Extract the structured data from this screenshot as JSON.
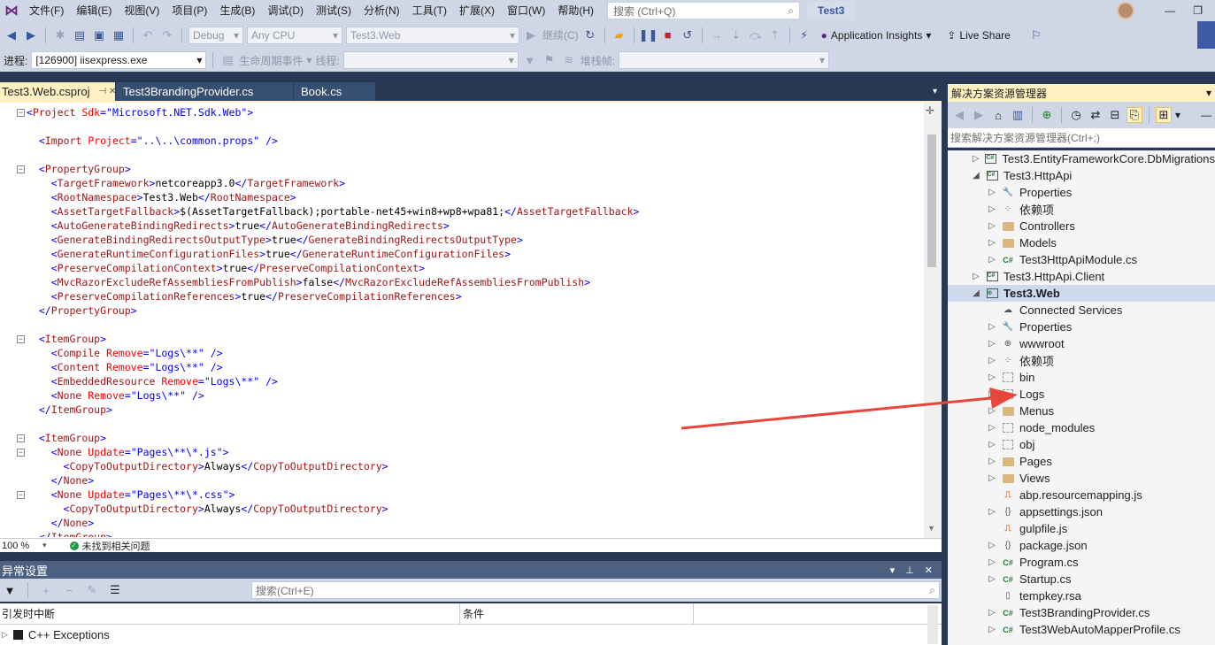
{
  "menubar": {
    "items": [
      "文件(F)",
      "编辑(E)",
      "视图(V)",
      "项目(P)",
      "生成(B)",
      "调试(D)",
      "测试(S)",
      "分析(N)",
      "工具(T)",
      "扩展(X)",
      "窗口(W)",
      "帮助(H)"
    ],
    "search_placeholder": "搜索 (Ctrl+Q)",
    "solution_title": "Test3"
  },
  "toolbar1": {
    "config": "Debug",
    "platform": "Any CPU",
    "startup_project": "Test3.Web",
    "continue_label": "继续(C)",
    "app_insights": "Application Insights",
    "live_share": "Live Share"
  },
  "toolbar2": {
    "process_label": "进程:",
    "process_value": "[126900] iisexpress.exe",
    "lifecycle_label": "生命周期事件",
    "thread_label": "线程:",
    "stackframe_label": "堆栈帧:"
  },
  "doc_tabs": [
    {
      "label": "Test3.Web.csproj",
      "active": true
    },
    {
      "label": "Test3BrandingProvider.cs",
      "active": false
    },
    {
      "label": "Book.cs",
      "active": false
    }
  ],
  "code_lines": [
    {
      "indent": 0,
      "fold": "-",
      "parts": [
        [
          "b",
          "<"
        ],
        [
          "t",
          "Project"
        ],
        [
          "a",
          " Sdk"
        ],
        [
          "b",
          "=\""
        ],
        [
          "s",
          "Microsoft.NET.Sdk.Web"
        ],
        [
          "b",
          "\">"
        ]
      ]
    },
    {
      "indent": 0,
      "parts": []
    },
    {
      "indent": 1,
      "parts": [
        [
          "b",
          "<"
        ],
        [
          "t",
          "Import"
        ],
        [
          "a",
          " Project"
        ],
        [
          "b",
          "=\""
        ],
        [
          "s",
          "..\\..\\common.props"
        ],
        [
          "b",
          "\" />"
        ]
      ]
    },
    {
      "indent": 0,
      "parts": []
    },
    {
      "indent": 1,
      "fold": "-",
      "parts": [
        [
          "b",
          "<"
        ],
        [
          "t",
          "PropertyGroup"
        ],
        [
          "b",
          ">"
        ]
      ]
    },
    {
      "indent": 2,
      "parts": [
        [
          "b",
          "<"
        ],
        [
          "t",
          "TargetFramework"
        ],
        [
          "b",
          ">"
        ],
        [
          "x",
          "netcoreapp3.0"
        ],
        [
          "b",
          "</"
        ],
        [
          "t",
          "TargetFramework"
        ],
        [
          "b",
          ">"
        ]
      ]
    },
    {
      "indent": 2,
      "parts": [
        [
          "b",
          "<"
        ],
        [
          "t",
          "RootNamespace"
        ],
        [
          "b",
          ">"
        ],
        [
          "x",
          "Test3.Web"
        ],
        [
          "b",
          "</"
        ],
        [
          "t",
          "RootNamespace"
        ],
        [
          "b",
          ">"
        ]
      ]
    },
    {
      "indent": 2,
      "parts": [
        [
          "b",
          "<"
        ],
        [
          "t",
          "AssetTargetFallback"
        ],
        [
          "b",
          ">"
        ],
        [
          "x",
          "$(AssetTargetFallback);portable-net45+win8+wp8+wpa81;"
        ],
        [
          "b",
          "</"
        ],
        [
          "t",
          "AssetTargetFallback"
        ],
        [
          "b",
          ">"
        ]
      ]
    },
    {
      "indent": 2,
      "parts": [
        [
          "b",
          "<"
        ],
        [
          "t",
          "AutoGenerateBindingRedirects"
        ],
        [
          "b",
          ">"
        ],
        [
          "x",
          "true"
        ],
        [
          "b",
          "</"
        ],
        [
          "t",
          "AutoGenerateBindingRedirects"
        ],
        [
          "b",
          ">"
        ]
      ]
    },
    {
      "indent": 2,
      "parts": [
        [
          "b",
          "<"
        ],
        [
          "t",
          "GenerateBindingRedirectsOutputType"
        ],
        [
          "b",
          ">"
        ],
        [
          "x",
          "true"
        ],
        [
          "b",
          "</"
        ],
        [
          "t",
          "GenerateBindingRedirectsOutputType"
        ],
        [
          "b",
          ">"
        ]
      ]
    },
    {
      "indent": 2,
      "parts": [
        [
          "b",
          "<"
        ],
        [
          "t",
          "GenerateRuntimeConfigurationFiles"
        ],
        [
          "b",
          ">"
        ],
        [
          "x",
          "true"
        ],
        [
          "b",
          "</"
        ],
        [
          "t",
          "GenerateRuntimeConfigurationFiles"
        ],
        [
          "b",
          ">"
        ]
      ]
    },
    {
      "indent": 2,
      "parts": [
        [
          "b",
          "<"
        ],
        [
          "t",
          "PreserveCompilationContext"
        ],
        [
          "b",
          ">"
        ],
        [
          "x",
          "true"
        ],
        [
          "b",
          "</"
        ],
        [
          "t",
          "PreserveCompilationContext"
        ],
        [
          "b",
          ">"
        ]
      ]
    },
    {
      "indent": 2,
      "parts": [
        [
          "b",
          "<"
        ],
        [
          "t",
          "MvcRazorExcludeRefAssembliesFromPublish"
        ],
        [
          "b",
          ">"
        ],
        [
          "x",
          "false"
        ],
        [
          "b",
          "</"
        ],
        [
          "t",
          "MvcRazorExcludeRefAssembliesFromPublish"
        ],
        [
          "b",
          ">"
        ]
      ]
    },
    {
      "indent": 2,
      "parts": [
        [
          "b",
          "<"
        ],
        [
          "t",
          "PreserveCompilationReferences"
        ],
        [
          "b",
          ">"
        ],
        [
          "x",
          "true"
        ],
        [
          "b",
          "</"
        ],
        [
          "t",
          "PreserveCompilationReferences"
        ],
        [
          "b",
          ">"
        ]
      ]
    },
    {
      "indent": 1,
      "parts": [
        [
          "b",
          "</"
        ],
        [
          "t",
          "PropertyGroup"
        ],
        [
          "b",
          ">"
        ]
      ]
    },
    {
      "indent": 0,
      "parts": []
    },
    {
      "indent": 1,
      "fold": "-",
      "parts": [
        [
          "b",
          "<"
        ],
        [
          "t",
          "ItemGroup"
        ],
        [
          "b",
          ">"
        ]
      ]
    },
    {
      "indent": 2,
      "parts": [
        [
          "b",
          "<"
        ],
        [
          "t",
          "Compile"
        ],
        [
          "a",
          " Remove"
        ],
        [
          "b",
          "=\""
        ],
        [
          "s",
          "Logs\\**"
        ],
        [
          "b",
          "\" />"
        ]
      ]
    },
    {
      "indent": 2,
      "parts": [
        [
          "b",
          "<"
        ],
        [
          "t",
          "Content"
        ],
        [
          "a",
          " Remove"
        ],
        [
          "b",
          "=\""
        ],
        [
          "s",
          "Logs\\**"
        ],
        [
          "b",
          "\" />"
        ]
      ]
    },
    {
      "indent": 2,
      "parts": [
        [
          "b",
          "<"
        ],
        [
          "t",
          "EmbeddedResource"
        ],
        [
          "a",
          " Remove"
        ],
        [
          "b",
          "=\""
        ],
        [
          "s",
          "Logs\\**"
        ],
        [
          "b",
          "\" />"
        ]
      ]
    },
    {
      "indent": 2,
      "parts": [
        [
          "b",
          "<"
        ],
        [
          "t",
          "None"
        ],
        [
          "a",
          " Remove"
        ],
        [
          "b",
          "=\""
        ],
        [
          "s",
          "Logs\\**"
        ],
        [
          "b",
          "\" />"
        ]
      ]
    },
    {
      "indent": 1,
      "parts": [
        [
          "b",
          "</"
        ],
        [
          "t",
          "ItemGroup"
        ],
        [
          "b",
          ">"
        ]
      ]
    },
    {
      "indent": 0,
      "parts": []
    },
    {
      "indent": 1,
      "fold": "-",
      "parts": [
        [
          "b",
          "<"
        ],
        [
          "t",
          "ItemGroup"
        ],
        [
          "b",
          ">"
        ]
      ]
    },
    {
      "indent": 2,
      "fold": "-",
      "parts": [
        [
          "b",
          "<"
        ],
        [
          "t",
          "None"
        ],
        [
          "a",
          " Update"
        ],
        [
          "b",
          "=\""
        ],
        [
          "s",
          "Pages\\**\\*.js"
        ],
        [
          "b",
          "\">"
        ]
      ]
    },
    {
      "indent": 3,
      "parts": [
        [
          "b",
          "<"
        ],
        [
          "t",
          "CopyToOutputDirectory"
        ],
        [
          "b",
          ">"
        ],
        [
          "x",
          "Always"
        ],
        [
          "b",
          "</"
        ],
        [
          "t",
          "CopyToOutputDirectory"
        ],
        [
          "b",
          ">"
        ]
      ]
    },
    {
      "indent": 2,
      "parts": [
        [
          "b",
          "</"
        ],
        [
          "t",
          "None"
        ],
        [
          "b",
          ">"
        ]
      ]
    },
    {
      "indent": 2,
      "fold": "-",
      "parts": [
        [
          "b",
          "<"
        ],
        [
          "t",
          "None"
        ],
        [
          "a",
          " Update"
        ],
        [
          "b",
          "=\""
        ],
        [
          "s",
          "Pages\\**\\*.css"
        ],
        [
          "b",
          "\">"
        ]
      ]
    },
    {
      "indent": 3,
      "parts": [
        [
          "b",
          "<"
        ],
        [
          "t",
          "CopyToOutputDirectory"
        ],
        [
          "b",
          ">"
        ],
        [
          "x",
          "Always"
        ],
        [
          "b",
          "</"
        ],
        [
          "t",
          "CopyToOutputDirectory"
        ],
        [
          "b",
          ">"
        ]
      ]
    },
    {
      "indent": 2,
      "parts": [
        [
          "b",
          "</"
        ],
        [
          "t",
          "None"
        ],
        [
          "b",
          ">"
        ]
      ]
    },
    {
      "indent": 1,
      "parts": [
        [
          "b",
          "</"
        ],
        [
          "t",
          "ItemGroup"
        ],
        [
          "b",
          ">"
        ]
      ]
    }
  ],
  "editor_status": {
    "zoom": "100 %",
    "issues": "未找到相关问题"
  },
  "exception_panel": {
    "title": "异常设置",
    "search_placeholder": "搜索(Ctrl+E)",
    "col_break": "引发时中断",
    "col_condition": "条件",
    "rows": [
      "C++ Exceptions"
    ]
  },
  "solution_explorer": {
    "title": "解决方案资源管理器",
    "search_placeholder": "搜索解决方案资源管理器(Ctrl+;)",
    "nodes": [
      {
        "level": 1,
        "exp": "▷",
        "icon": "project",
        "label": "Test3.EntityFrameworkCore.DbMigrations"
      },
      {
        "level": 1,
        "exp": "◢",
        "icon": "project",
        "label": "Test3.HttpApi"
      },
      {
        "level": 2,
        "exp": "▷",
        "icon": "wrench",
        "label": "Properties"
      },
      {
        "level": 2,
        "exp": "▷",
        "icon": "deps",
        "label": "依赖项"
      },
      {
        "level": 2,
        "exp": "▷",
        "icon": "folder",
        "label": "Controllers"
      },
      {
        "level": 2,
        "exp": "▷",
        "icon": "folder",
        "label": "Models"
      },
      {
        "level": 2,
        "exp": "▷",
        "icon": "cs",
        "label": "Test3HttpApiModule.cs"
      },
      {
        "level": 1,
        "exp": "▷",
        "icon": "project",
        "label": "Test3.HttpApi.Client"
      },
      {
        "level": 1,
        "exp": "◢",
        "icon": "webproject",
        "label": "Test3.Web",
        "selected": true
      },
      {
        "level": 2,
        "exp": "",
        "icon": "services",
        "label": "Connected Services"
      },
      {
        "level": 2,
        "exp": "▷",
        "icon": "wrench",
        "label": "Properties"
      },
      {
        "level": 2,
        "exp": "▷",
        "icon": "globe",
        "label": "wwwroot"
      },
      {
        "level": 2,
        "exp": "▷",
        "icon": "deps",
        "label": "依赖项"
      },
      {
        "level": 2,
        "exp": "▷",
        "icon": "ghost",
        "label": "bin"
      },
      {
        "level": 2,
        "exp": "▷",
        "icon": "ghost",
        "label": "Logs"
      },
      {
        "level": 2,
        "exp": "▷",
        "icon": "folder",
        "label": "Menus"
      },
      {
        "level": 2,
        "exp": "▷",
        "icon": "ghost",
        "label": "node_modules"
      },
      {
        "level": 2,
        "exp": "▷",
        "icon": "ghost",
        "label": "obj"
      },
      {
        "level": 2,
        "exp": "▷",
        "icon": "folder",
        "label": "Pages"
      },
      {
        "level": 2,
        "exp": "▷",
        "icon": "folder",
        "label": "Views"
      },
      {
        "level": 2,
        "exp": "",
        "icon": "js",
        "label": "abp.resourcemapping.js"
      },
      {
        "level": 2,
        "exp": "▷",
        "icon": "json",
        "label": "appsettings.json"
      },
      {
        "level": 2,
        "exp": "",
        "icon": "js",
        "label": "gulpfile.js"
      },
      {
        "level": 2,
        "exp": "▷",
        "icon": "json",
        "label": "package.json"
      },
      {
        "level": 2,
        "exp": "▷",
        "icon": "cs",
        "label": "Program.cs"
      },
      {
        "level": 2,
        "exp": "▷",
        "icon": "cs",
        "label": "Startup.cs"
      },
      {
        "level": 2,
        "exp": "",
        "icon": "file",
        "label": "tempkey.rsa"
      },
      {
        "level": 2,
        "exp": "▷",
        "icon": "cs",
        "label": "Test3BrandingProvider.cs"
      },
      {
        "level": 2,
        "exp": "▷",
        "icon": "cs",
        "label": "Test3WebAutoMapperProfile.cs"
      }
    ]
  },
  "annotation": {
    "arrow_color": "#e8453c"
  }
}
